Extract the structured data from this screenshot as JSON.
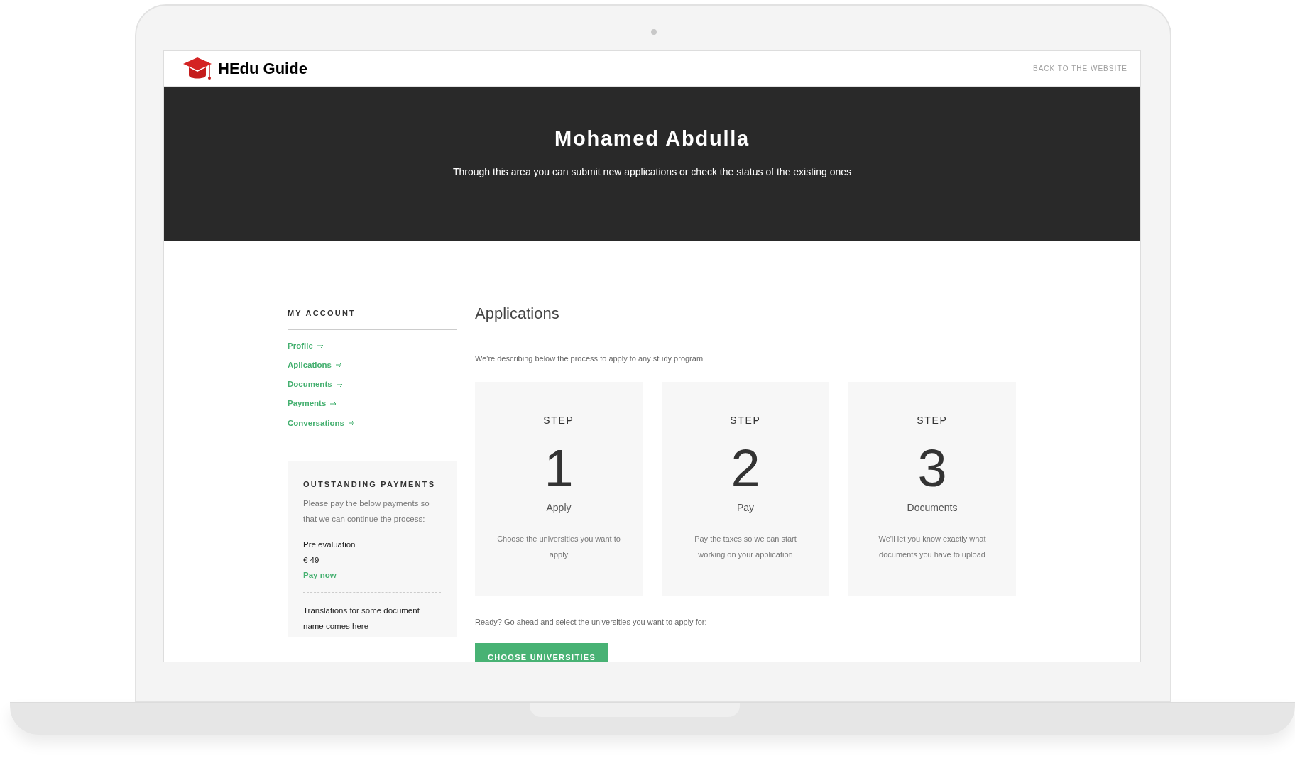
{
  "header": {
    "logo_text": "HEdu Guide",
    "back_link": "BACK TO THE WEBSITE"
  },
  "hero": {
    "title": "Mohamed Abdulla",
    "subtitle": "Through this area you can submit new applications or check the status of the existing ones"
  },
  "sidebar": {
    "heading": "MY ACCOUNT",
    "items": [
      "Profile",
      "Aplications",
      "Documents",
      "Payments",
      "Conversations"
    ]
  },
  "outstanding_payments": {
    "heading": "OUTSTANDING PAYMENTS",
    "intro": "Please pay the below payments so that we can continue the process:",
    "payments": [
      {
        "name": "Pre evaluation",
        "amount": "€ 49",
        "action": "Pay now"
      },
      {
        "name": "Translations for some document name comes here"
      }
    ]
  },
  "main": {
    "title": "Applications",
    "intro": "We're describing below the process to apply to any study program",
    "steps": [
      {
        "label": "STEP",
        "number": "1",
        "title": "Apply",
        "description": "Choose the universities you want to apply"
      },
      {
        "label": "STEP",
        "number": "2",
        "title": "Pay",
        "description": "Pay the taxes so we can start working on your application"
      },
      {
        "label": "STEP",
        "number": "3",
        "title": "Documents",
        "description": "We'll let you know exactly what documents you have to upload"
      }
    ],
    "ready_text": "Ready? Go ahead and select the universities you want to apply for:",
    "button": "CHOOSE UNIVERSITIES"
  }
}
